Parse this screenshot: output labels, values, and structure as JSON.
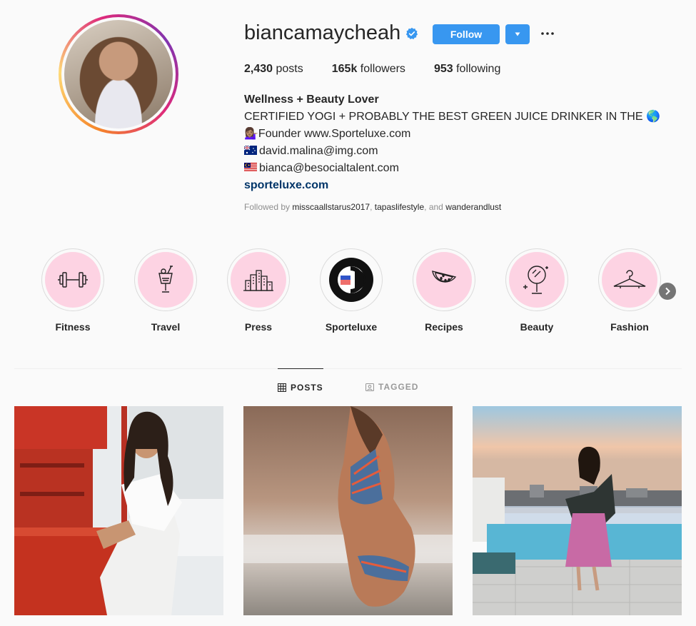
{
  "profile": {
    "username": "biancamaycheah",
    "follow_label": "Follow",
    "stats": {
      "posts_count": "2,430",
      "posts_label": "posts",
      "followers_count": "165k",
      "followers_label": "followers",
      "following_count": "953",
      "following_label": "following"
    },
    "bio": {
      "name": "Wellness + Beauty Lover",
      "line1": "CERTIFIED YOGI + PROBABLY THE BEST GREEN JUICE DRINKER IN THE",
      "line1_emoji": "🌎",
      "line2_emoji": "💁🏽‍♀️",
      "line2": "Founder www.Sporteluxe.com",
      "line3": "david.malina@img.com",
      "line4": "bianca@besocialtalent.com",
      "link": "sporteluxe.com"
    },
    "followed_by": {
      "prefix": "Followed by",
      "user1": "misscaallstarus2017",
      "sep": ",",
      "user2": "tapaslifestyle",
      "and": ", and",
      "user3": "wanderandlust"
    }
  },
  "highlights": [
    {
      "label": "Fitness",
      "icon": "dumbbell-icon"
    },
    {
      "label": "Travel",
      "icon": "cocktail-icon"
    },
    {
      "label": "Press",
      "icon": "city-buildings-icon"
    },
    {
      "label": "Sporteluxe",
      "icon": "sporteluxe-logo-icon"
    },
    {
      "label": "Recipes",
      "icon": "watermelon-icon"
    },
    {
      "label": "Beauty",
      "icon": "mirror-icon"
    },
    {
      "label": "Fashion",
      "icon": "hanger-icon"
    }
  ],
  "tabs": [
    {
      "label": "POSTS",
      "icon": "grid-icon",
      "active": true
    },
    {
      "label": "TAGGED",
      "icon": "tag-user-icon",
      "active": false
    }
  ],
  "colors": {
    "accent": "#3897f0",
    "highlight_bg": "#fdd3e3",
    "link": "#003569"
  }
}
